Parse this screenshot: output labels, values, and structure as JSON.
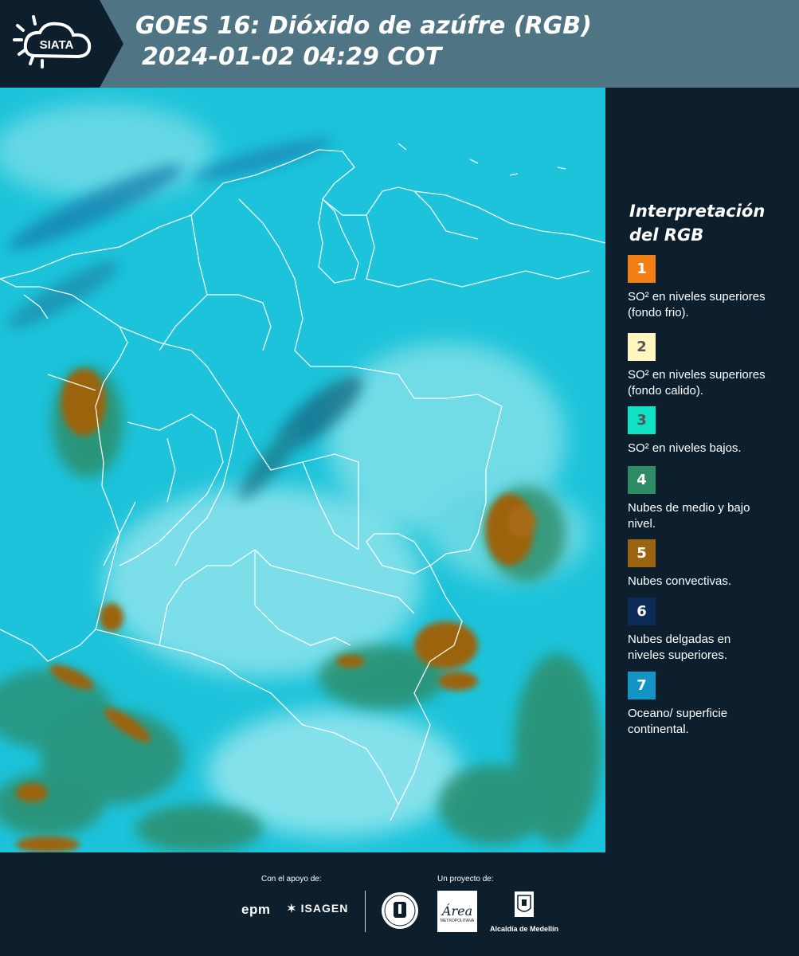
{
  "header": {
    "logo_text": "SIATA",
    "title": "GOES 16: Dióxido de azúfre (RGB)",
    "subtitle": "2024-01-02 04:29 COT"
  },
  "legend": {
    "title": "Interpretación del RGB",
    "items": [
      {
        "number": "1",
        "color": "#f57f17",
        "number_color": "#ffffff",
        "description": "SO² en niveles superiores (fondo frio)."
      },
      {
        "number": "2",
        "color": "#fff6c0",
        "number_color": "#555555",
        "description": "SO² en niveles superiores (fondo calido)."
      },
      {
        "number": "3",
        "color": "#12e2c4",
        "number_color": "#555555",
        "description": "SO² en niveles bajos."
      },
      {
        "number": "4",
        "color": "#2e8b65",
        "number_color": "#ffffff",
        "description": "Nubes de medio y bajo nivel."
      },
      {
        "number": "5",
        "color": "#9c6311",
        "number_color": "#ffffff",
        "description": "Nubes convectivas."
      },
      {
        "number": "6",
        "color": "#0b2c59",
        "number_color": "#ffffff",
        "description": "Nubes delgadas en niveles superiores."
      },
      {
        "number": "7",
        "color": "#1394c4",
        "number_color": "#ffffff",
        "description": "Oceano/ superficie continental."
      }
    ]
  },
  "footer": {
    "support_label": "Con el apoyo de:",
    "project_label": "Un proyecto de:",
    "sponsors": [
      "epm",
      "ISAGEN"
    ],
    "partners": [
      "Área Metropolitana Valle de Aburrá",
      "Alcaldía de Medellín"
    ],
    "area_logo_text": "Área",
    "area_logo_caption": "METROPOLITANA",
    "alcaldia_name": "Alcaldía de Medellín"
  },
  "map": {
    "background_color": "#1cc3da",
    "region": "Colombia"
  }
}
